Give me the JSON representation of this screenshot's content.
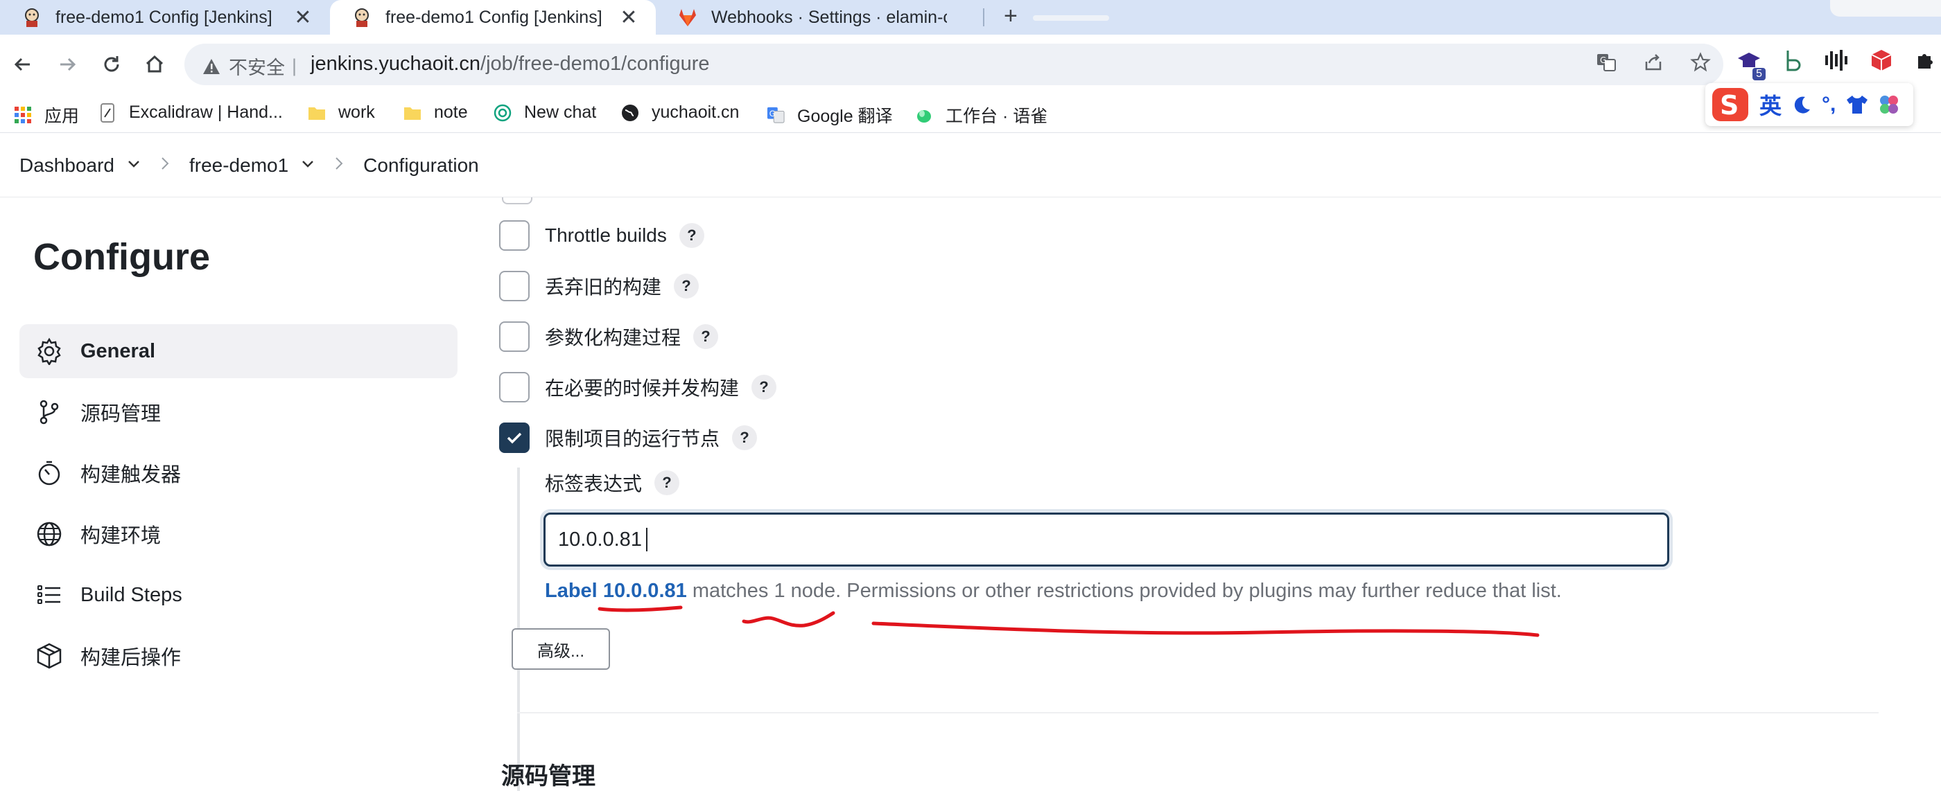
{
  "browser": {
    "tabs": [
      {
        "title": "free-demo1 Config [Jenkins]",
        "active": false
      },
      {
        "title": "free-demo1 Config [Jenkins]",
        "active": true
      },
      {
        "title": "Webhooks · Settings · elamin-c",
        "active": false
      }
    ],
    "insecure_label": "不安全",
    "url_host": "jenkins.yuchaoit.cn",
    "url_path": "/job/free-demo1/configure",
    "extension_badge": "5"
  },
  "bookmarks": [
    {
      "label": "应用",
      "icon": "apps-grid-icon"
    },
    {
      "label": "Excalidraw | Hand...",
      "icon": "excalidraw-icon"
    },
    {
      "label": "work",
      "icon": "folder-icon"
    },
    {
      "label": "note",
      "icon": "folder-icon"
    },
    {
      "label": "New chat",
      "icon": "openai-icon"
    },
    {
      "label": "yuchaoit.cn",
      "icon": "globe-icon"
    },
    {
      "label": "Google 翻译",
      "icon": "google-translate-icon"
    },
    {
      "label": "工作台 · 语雀",
      "icon": "yuque-icon"
    }
  ],
  "ime": {
    "mode": "英"
  },
  "breadcrumb": {
    "dashboard": "Dashboard",
    "job": "free-demo1",
    "current": "Configuration"
  },
  "sidebar": {
    "title": "Configure",
    "items": [
      {
        "label": "General",
        "icon": "gear-icon",
        "active": true
      },
      {
        "label": "源码管理",
        "icon": "branch-icon",
        "active": false
      },
      {
        "label": "构建触发器",
        "icon": "timer-icon",
        "active": false
      },
      {
        "label": "构建环境",
        "icon": "globe-icon",
        "active": false
      },
      {
        "label": "Build Steps",
        "icon": "list-icon",
        "active": false
      },
      {
        "label": "构建后操作",
        "icon": "package-icon",
        "active": false
      }
    ]
  },
  "form": {
    "options": [
      {
        "label": "Throttle builds",
        "checked": false
      },
      {
        "label": "丢弃旧的构建",
        "checked": false
      },
      {
        "label": "参数化构建过程",
        "checked": false
      },
      {
        "label": "在必要的时候并发构建",
        "checked": false
      },
      {
        "label": "限制项目的运行节点",
        "checked": true
      }
    ],
    "help_glyph": "?",
    "label_expression": {
      "label": "标签表达式",
      "value": "10.0.0.81"
    },
    "validation": {
      "prefix": "Label",
      "label": "10.0.0.81",
      "suffix": "matches 1 node. Permissions or other restrictions provided by plugins may further reduce that list."
    },
    "advanced_button": "高级...",
    "next_section": "源码管理"
  },
  "colors": {
    "accent_dark": "#1e3a56",
    "link_blue": "#2063b5",
    "annotation_red": "#e0141c",
    "tabstrip_bg": "#d7e3f6"
  }
}
